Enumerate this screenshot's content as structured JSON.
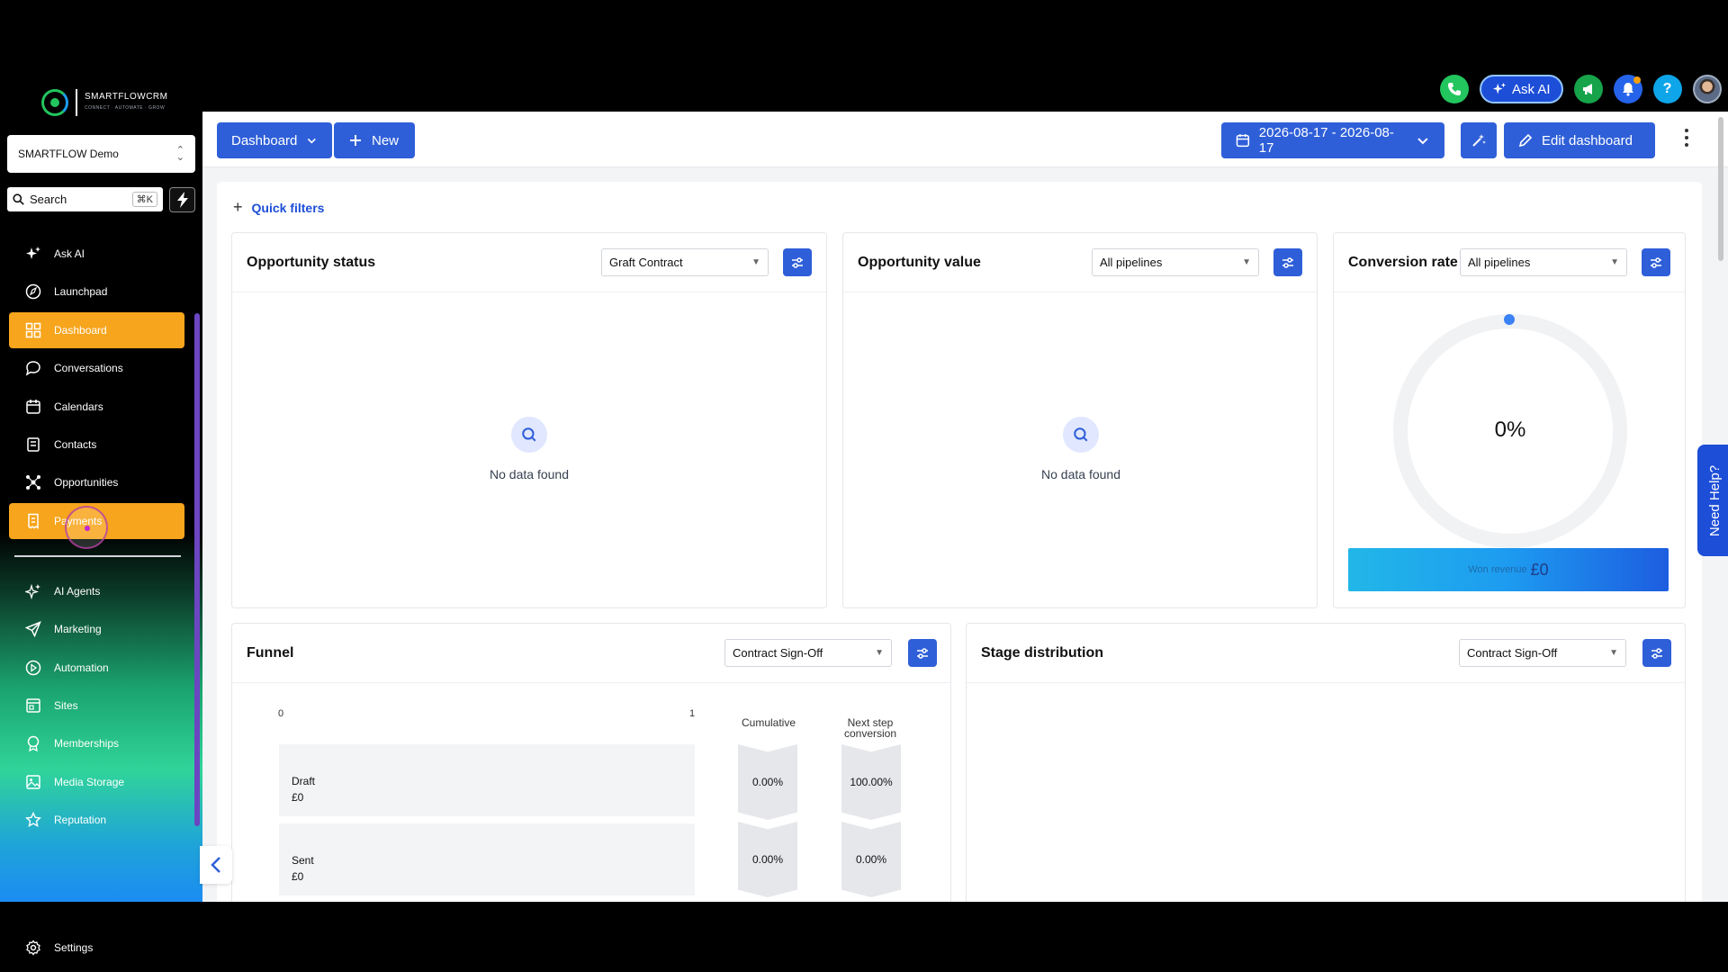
{
  "brand": {
    "name": "SMARTFLOWCRM",
    "tagline": "CONNECT · AUTOMATE · GROW",
    "accent": "#f7a51c",
    "primary": "#2f5fd8"
  },
  "sidebar": {
    "account": "SMARTFLOW Demo",
    "search_placeholder": "Search",
    "search_shortcut": "⌘K",
    "items": [
      {
        "label": "Ask AI",
        "icon": "sparkle-icon"
      },
      {
        "label": "Launchpad",
        "icon": "rocket-icon"
      },
      {
        "label": "Dashboard",
        "icon": "grid-icon",
        "active": true
      },
      {
        "label": "Conversations",
        "icon": "chat-icon"
      },
      {
        "label": "Calendars",
        "icon": "calendar-icon"
      },
      {
        "label": "Contacts",
        "icon": "contacts-icon"
      },
      {
        "label": "Opportunities",
        "icon": "network-icon"
      },
      {
        "label": "Payments",
        "icon": "receipt-icon",
        "active": true
      }
    ],
    "items2": [
      {
        "label": "AI Agents",
        "icon": "ai-sparkle-icon"
      },
      {
        "label": "Marketing",
        "icon": "send-icon"
      },
      {
        "label": "Automation",
        "icon": "automation-icon"
      },
      {
        "label": "Sites",
        "icon": "sites-icon"
      },
      {
        "label": "Memberships",
        "icon": "badge-icon"
      },
      {
        "label": "Media Storage",
        "icon": "image-icon"
      },
      {
        "label": "Reputation",
        "icon": "star-icon"
      }
    ],
    "settings": "Settings"
  },
  "topbar": {
    "ask_ai": "Ask AI"
  },
  "header": {
    "dashboard_btn": "Dashboard",
    "new_btn": "New",
    "date_range": "2026-08-17 - 2026-08-17",
    "edit_btn": "Edit dashboard"
  },
  "quick_filters": "Quick filters",
  "cards": {
    "opp_status": {
      "title": "Opportunity status",
      "select": "Graft Contract",
      "empty": "No data found"
    },
    "opp_value": {
      "title": "Opportunity value",
      "select": "All pipelines",
      "empty": "No data found"
    },
    "conversion": {
      "title": "Conversion rate",
      "select": "All pipelines",
      "value": "0%",
      "won_label": "Won revenue",
      "won_amount": "£0"
    },
    "funnel": {
      "title": "Funnel",
      "select": "Contract Sign-Off",
      "axis_min": "0",
      "axis_max": "1",
      "col_cumulative": "Cumulative",
      "col_next": "Next step conversion",
      "rows": [
        {
          "stage": "Draft",
          "amount": "£0",
          "cumulative": "0.00%",
          "next": "100.00%"
        },
        {
          "stage": "Sent",
          "amount": "£0",
          "cumulative": "0.00%",
          "next": "0.00%"
        }
      ]
    },
    "stage_dist": {
      "title": "Stage distribution",
      "select": "Contract Sign-Off"
    }
  },
  "need_help": "Need Help?"
}
